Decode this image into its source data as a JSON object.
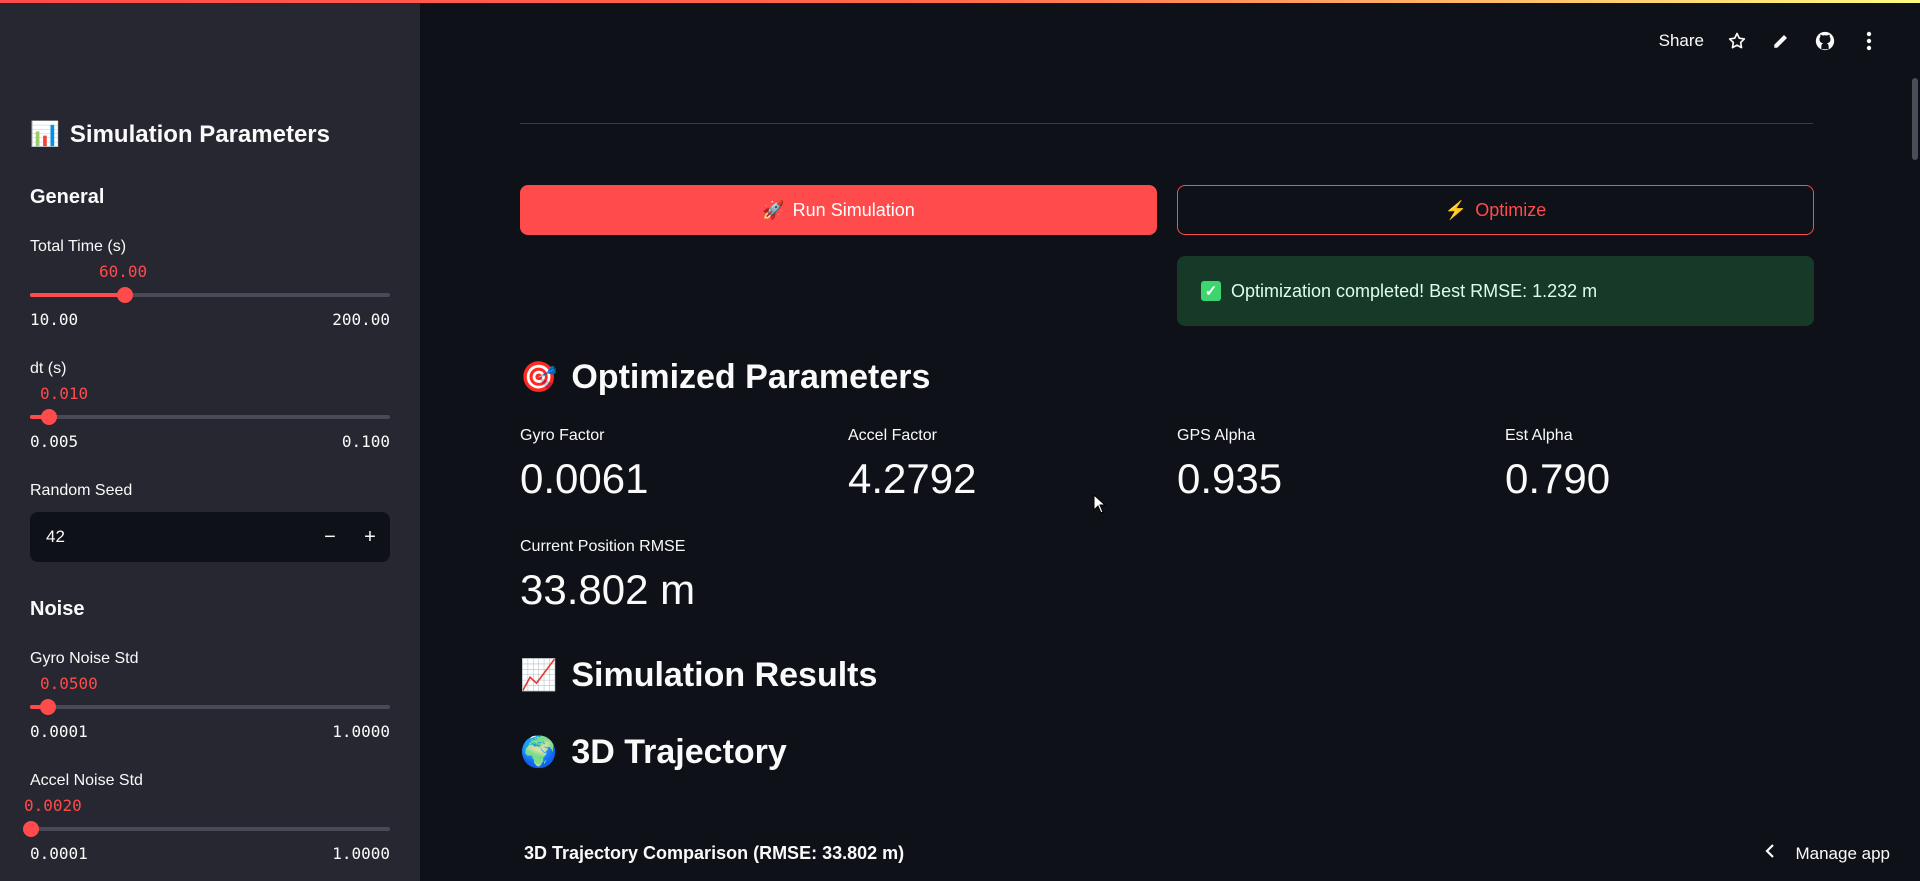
{
  "colors": {
    "accent": "#ff4b4b",
    "success_bg": "#173928",
    "sidebar_bg": "#262730",
    "main_bg": "#0e1117"
  },
  "sidebar": {
    "title": "Simulation Parameters",
    "title_icon": "bar-chart-icon",
    "general_heading": "General",
    "total_time": {
      "label": "Total Time (s)",
      "value": "60.00",
      "min": "10.00",
      "max": "200.00",
      "fraction": 0.263
    },
    "dt": {
      "label": "dt (s)",
      "value": "0.010",
      "min": "0.005",
      "max": "0.100",
      "fraction": 0.053
    },
    "random_seed": {
      "label": "Random Seed",
      "value": "42",
      "minus": "−",
      "plus": "+"
    },
    "noise_heading": "Noise",
    "gyro_noise": {
      "label": "Gyro Noise Std",
      "value": "0.0500",
      "min": "0.0001",
      "max": "1.0000",
      "fraction": 0.05
    },
    "accel_noise": {
      "label": "Accel Noise Std",
      "value": "0.0020",
      "min": "0.0001",
      "max": "1.0000",
      "fraction": 0.002
    }
  },
  "toolbar": {
    "share": "Share"
  },
  "actions": {
    "run_label": "Run Simulation",
    "optimize_label": "Optimize",
    "success_message": "Optimization completed! Best RMSE: 1.232 m"
  },
  "optimized": {
    "heading": "Optimized Parameters",
    "metrics": [
      {
        "label": "Gyro Factor",
        "value": "0.0061"
      },
      {
        "label": "Accel Factor",
        "value": "4.2792"
      },
      {
        "label": "GPS Alpha",
        "value": "0.935"
      },
      {
        "label": "Est Alpha",
        "value": "0.790"
      }
    ],
    "rmse": {
      "label": "Current Position RMSE",
      "value": "33.802 m"
    }
  },
  "results": {
    "heading": "Simulation Results",
    "trajectory_heading": "3D Trajectory",
    "chart_title": "3D Trajectory Comparison (RMSE: 33.802 m)"
  },
  "manage_app": "Manage app"
}
